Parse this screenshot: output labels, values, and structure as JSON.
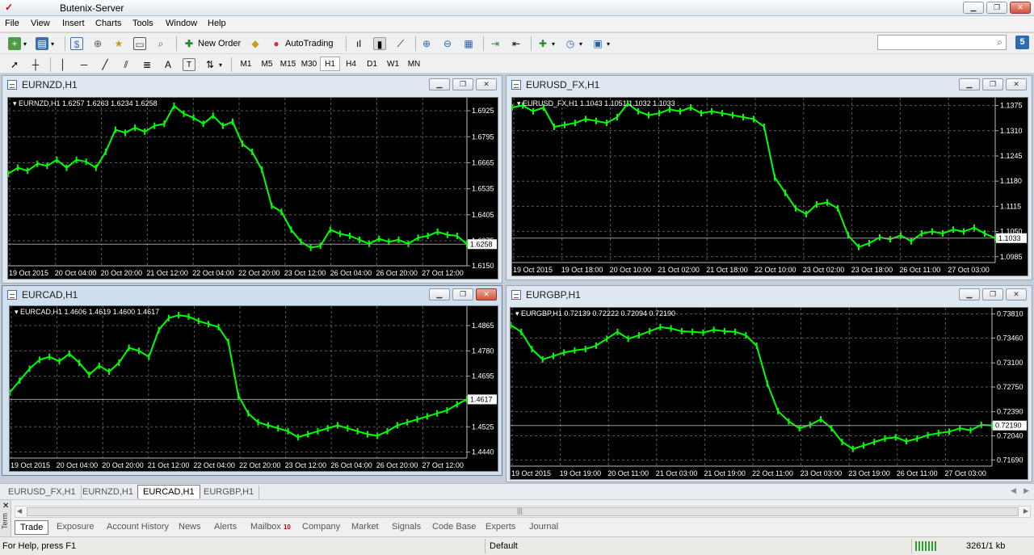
{
  "app": {
    "title": "Butenix-Server"
  },
  "menu": [
    "File",
    "View",
    "Insert",
    "Charts",
    "Tools",
    "Window",
    "Help"
  ],
  "toolbar": {
    "new_order": "New Order",
    "autotrading": "AutoTrading"
  },
  "timeframes": [
    "M1",
    "M5",
    "M15",
    "M30",
    "H1",
    "H4",
    "D1",
    "W1",
    "MN"
  ],
  "timeframe_active": "H1",
  "charts": [
    {
      "window_title": "EURNZD,H1",
      "header": "EURNZD,H1  1.6257 1.6263 1.6234 1.6258",
      "price_labels": [
        "1.6925",
        "1.6795",
        "1.6665",
        "1.6535",
        "1.6405",
        "1.6275",
        "1.6150"
      ],
      "current_price": "1.6258",
      "x_labels": [
        "19 Oct 2015",
        "20 Oct 04:00",
        "20 Oct 20:00",
        "21 Oct 12:00",
        "22 Oct 04:00",
        "22 Oct 20:00",
        "23 Oct 12:00",
        "26 Oct 04:00",
        "26 Oct 20:00",
        "27 Oct 12:00"
      ],
      "chart_data": {
        "type": "line",
        "ylim": [
          1.615,
          1.699
        ],
        "values": [
          1.661,
          1.664,
          1.6625,
          1.666,
          1.665,
          1.668,
          1.664,
          1.668,
          1.667,
          1.664,
          1.672,
          1.683,
          1.6815,
          1.684,
          1.682,
          1.685,
          1.686,
          1.695,
          1.691,
          1.689,
          1.686,
          1.69,
          1.685,
          1.687,
          1.676,
          1.672,
          1.663,
          1.645,
          1.642,
          1.633,
          1.627,
          1.624,
          1.625,
          1.633,
          1.631,
          1.63,
          1.628,
          1.626,
          1.6285,
          1.627,
          1.628,
          1.626,
          1.629,
          1.63,
          1.632,
          1.6305,
          1.63,
          1.6258
        ]
      }
    },
    {
      "window_title": "EURUSD_FX,H1",
      "header": "EURUSD_FX,H1  1.1043 1.1051 1.1032 1.1033",
      "price_labels": [
        "1.1375",
        "1.1310",
        "1.1245",
        "1.1180",
        "1.1115",
        "1.1050",
        "1.0985"
      ],
      "current_price": "1.1033",
      "x_labels": [
        "19 Oct 2015",
        "19 Oct 18:00",
        "20 Oct 10:00",
        "21 Oct 02:00",
        "21 Oct 18:00",
        "22 Oct 10:00",
        "23 Oct 02:00",
        "23 Oct 18:00",
        "26 Oct 11:00",
        "27 Oct 03:00"
      ],
      "chart_data": {
        "type": "line",
        "ylim": [
          1.097,
          1.1395
        ],
        "values": [
          1.137,
          1.1375,
          1.136,
          1.137,
          1.132,
          1.1325,
          1.133,
          1.134,
          1.1335,
          1.133,
          1.1345,
          1.138,
          1.136,
          1.135,
          1.1355,
          1.1365,
          1.136,
          1.137,
          1.1355,
          1.136,
          1.1355,
          1.135,
          1.1345,
          1.134,
          1.132,
          1.119,
          1.115,
          1.111,
          1.1095,
          1.112,
          1.1125,
          1.111,
          1.104,
          1.101,
          1.102,
          1.1035,
          1.103,
          1.104,
          1.1025,
          1.1045,
          1.105,
          1.1045,
          1.1055,
          1.105,
          1.106,
          1.1045,
          1.1033
        ]
      }
    },
    {
      "window_title": "EURCAD,H1",
      "header": "EURCAD,H1  1.4606 1.4619 1.4600 1.4617",
      "price_labels": [
        "1.4865",
        "1.4780",
        "1.4695",
        "1.4610",
        "1.4525",
        "1.4440"
      ],
      "current_price": "1.4617",
      "x_labels": [
        "19 Oct 2015",
        "20 Oct 04:00",
        "20 Oct 20:00",
        "21 Oct 12:00",
        "22 Oct 04:00",
        "22 Oct 20:00",
        "23 Oct 12:00",
        "26 Oct 04:00",
        "26 Oct 20:00",
        "27 Oct 12:00"
      ],
      "chart_data": {
        "type": "line",
        "ylim": [
          1.442,
          1.493
        ],
        "values": [
          1.464,
          1.468,
          1.472,
          1.475,
          1.476,
          1.4745,
          1.477,
          1.474,
          1.47,
          1.473,
          1.471,
          1.474,
          1.479,
          1.478,
          1.476,
          1.485,
          1.489,
          1.49,
          1.4895,
          1.488,
          1.487,
          1.486,
          1.481,
          1.463,
          1.457,
          1.454,
          1.453,
          1.452,
          1.451,
          1.449,
          1.45,
          1.451,
          1.452,
          1.453,
          1.452,
          1.451,
          1.45,
          1.4495,
          1.451,
          1.453,
          1.454,
          1.455,
          1.456,
          1.457,
          1.458,
          1.46,
          1.4617
        ]
      }
    },
    {
      "window_title": "EURGBP,H1",
      "header": "EURGBP,H1  0.72139 0.72222 0.72094 0.72190",
      "price_labels": [
        "0.73810",
        "0.73460",
        "0.73100",
        "0.72750",
        "0.72390",
        "0.72040",
        "0.71690"
      ],
      "current_price": "0.72190",
      "x_labels": [
        "19 Oct 2015",
        "19 Oct 19:00",
        "20 Oct 11:00",
        "21 Oct 03:00",
        "21 Oct 19:00",
        "22 Oct 11:00",
        "23 Oct 03:00",
        "23 Oct 19:00",
        "26 Oct 11:00",
        "27 Oct 03:00"
      ],
      "chart_data": {
        "type": "line",
        "ylim": [
          0.716,
          0.739
        ],
        "values": [
          0.7365,
          0.7355,
          0.733,
          0.7315,
          0.732,
          0.7325,
          0.7328,
          0.733,
          0.7335,
          0.7345,
          0.7355,
          0.7345,
          0.735,
          0.7356,
          0.7362,
          0.736,
          0.7356,
          0.7355,
          0.7354,
          0.7358,
          0.7356,
          0.7355,
          0.735,
          0.7335,
          0.728,
          0.724,
          0.7225,
          0.7215,
          0.722,
          0.7228,
          0.7215,
          0.7195,
          0.7185,
          0.719,
          0.7195,
          0.72,
          0.7202,
          0.7196,
          0.72,
          0.7205,
          0.7208,
          0.721,
          0.7215,
          0.7212,
          0.722,
          0.7219
        ]
      }
    }
  ],
  "window_tabs": [
    "EURUSD_FX,H1",
    "EURNZD,H1",
    "EURCAD,H1",
    "EURGBP,H1"
  ],
  "window_tab_active": "EURCAD,H1",
  "terminal": {
    "side_label": "Term",
    "tabs": [
      "Trade",
      "Exposure",
      "Account History",
      "News",
      "Alerts",
      "Mailbox",
      "Company",
      "Market",
      "Signals",
      "Code Base",
      "Experts",
      "Journal"
    ],
    "mailbox_badge": "10"
  },
  "status": {
    "help": "For Help, press F1",
    "profile": "Default",
    "traffic": "3261/1 kb"
  },
  "colors": {
    "chart_bg": "#000000",
    "candles": "#00ff00",
    "grid": "#5a5a5a",
    "text": "#ffffff"
  }
}
